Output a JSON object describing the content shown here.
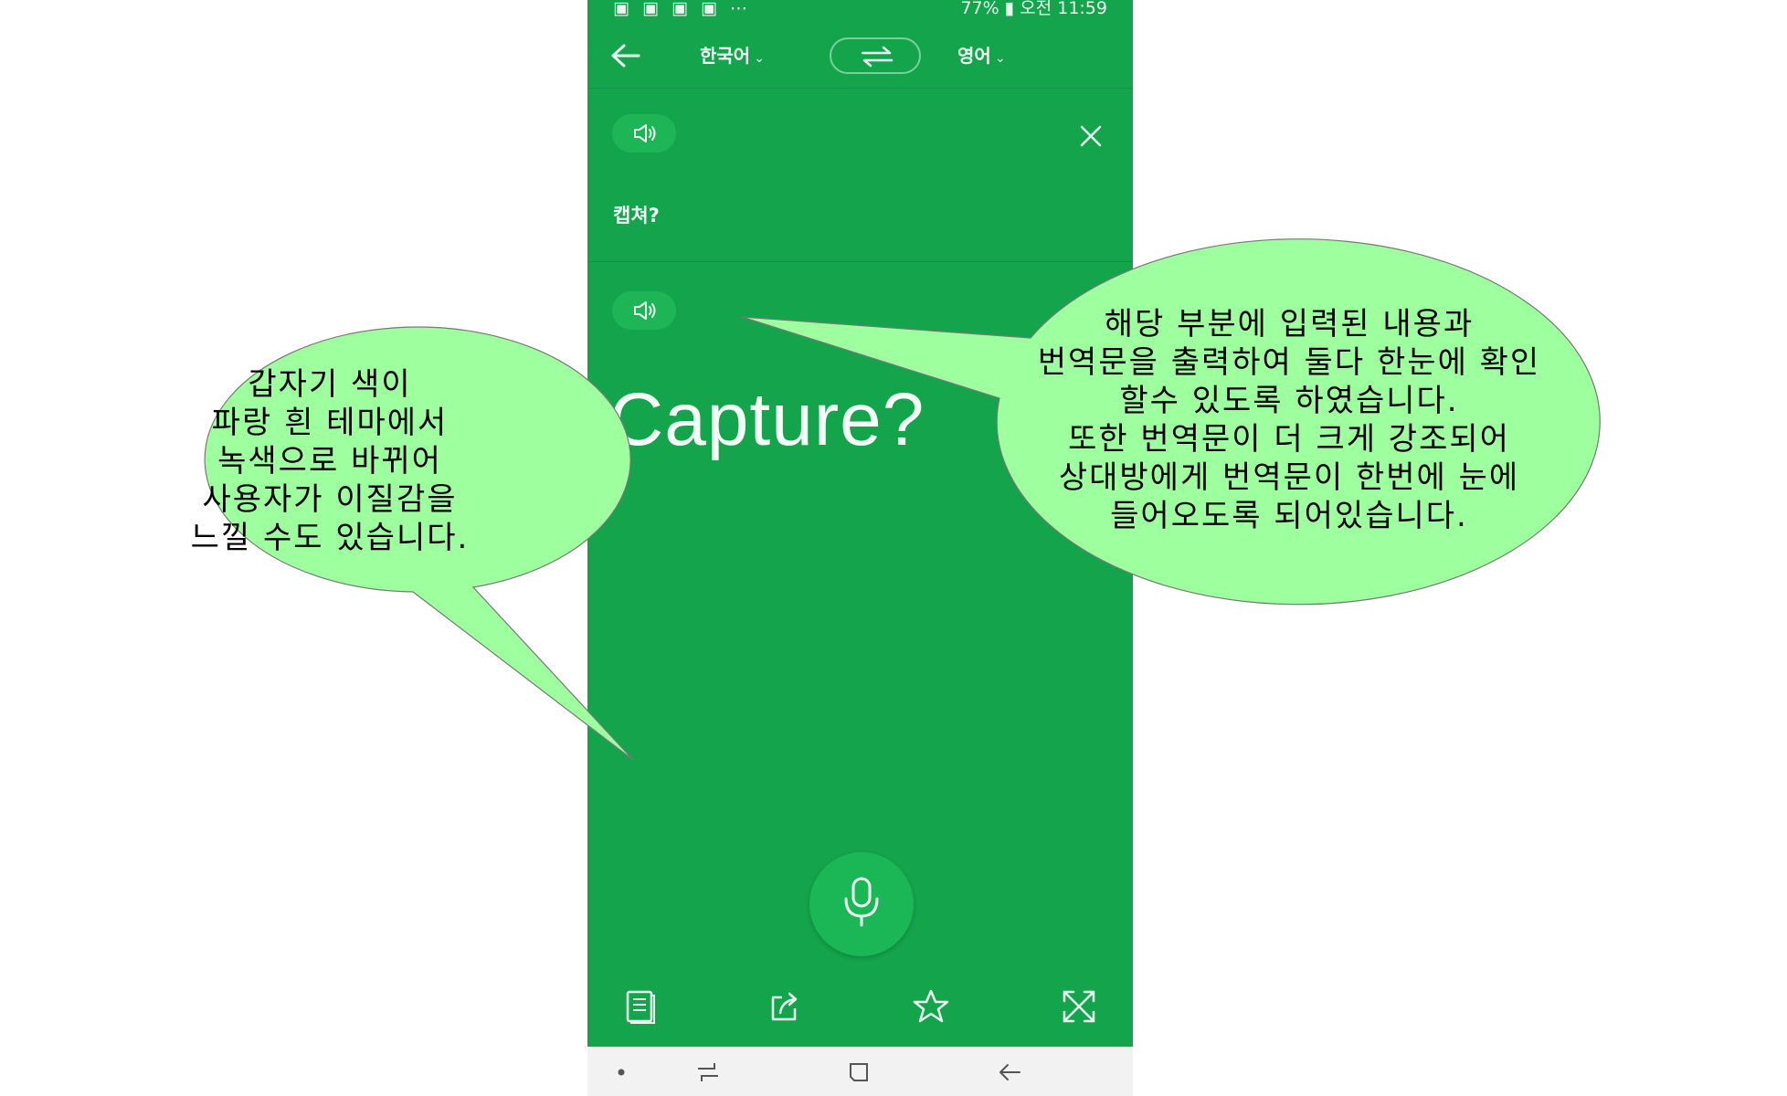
{
  "status_bar": {
    "left_icons": "▣ ▣ ▣ ▣ ⋯",
    "right_text": "77% ▮ 오전 11:59"
  },
  "toolbar": {
    "source_lang": "한국어",
    "target_lang": "영어",
    "chevron": "⌄"
  },
  "source": {
    "text": "캡쳐?"
  },
  "target": {
    "text": "Capture?"
  },
  "callout_left": {
    "lines": [
      "갑자기 색이",
      "파랑 흰 테마에서",
      "녹색으로 바뀌어",
      "사용자가 이질감을",
      "느낄 수도 있습니다."
    ]
  },
  "callout_right": {
    "lines": [
      "해당 부분에 입력된 내용과",
      "번역문을 출력하여 둘다 한눈에 확인",
      "할수 있도록 하였습니다.",
      "또한 번역문이 더 크게 강조되어",
      "상대방에게 번역문이 한번에 눈에",
      "들어오도록 되어있습니다."
    ]
  },
  "colors": {
    "app_green": "#14a54c",
    "callout_fill": "#9eff9e",
    "navbar": "#f2f2f2"
  }
}
